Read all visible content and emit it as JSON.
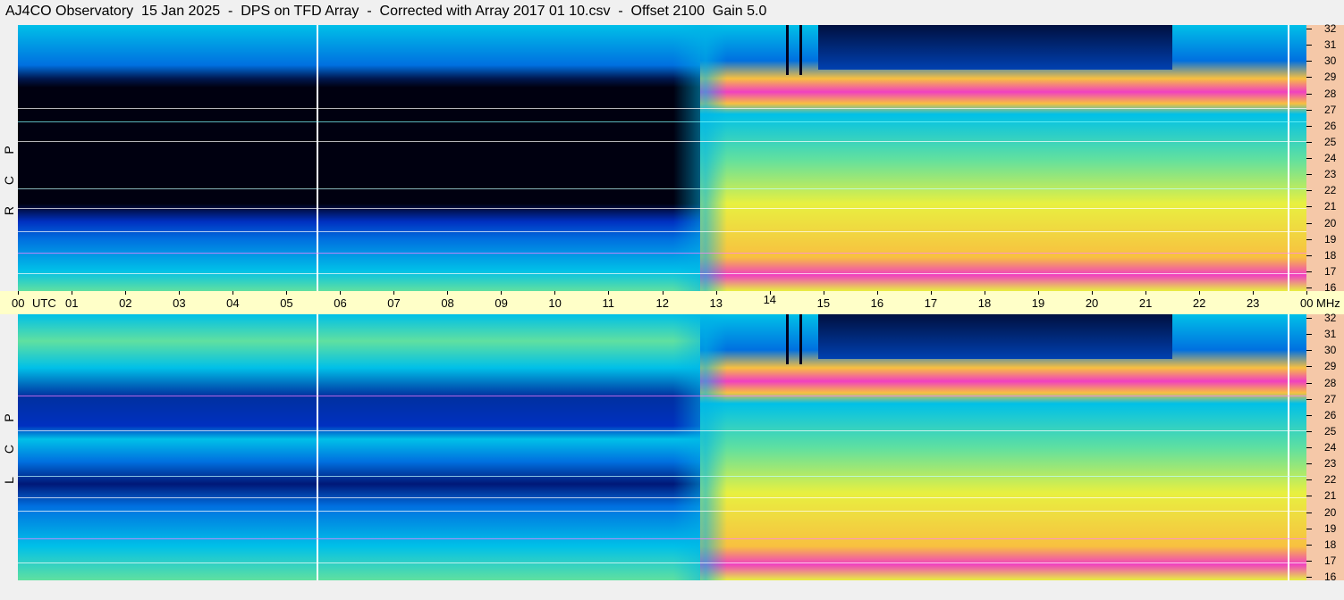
{
  "header": {
    "title": "AJ4CO Observatory  15 Jan 2025  -  DPS on TFD Array  -  Corrected with Array 2017 01 10.csv  -  Offset 2100  Gain 5.0"
  },
  "chart_data": {
    "type": "heatmap",
    "title": "AJ4CO Observatory  15 Jan 2025  -  DPS on TFD Array  -  Corrected with Array 2017 01 10.csv  -  Offset 2100  Gain 5.0",
    "x_axis": {
      "unit_label": "UTC",
      "tick_labels": [
        "00",
        "01",
        "02",
        "03",
        "04",
        "05",
        "06",
        "07",
        "08",
        "09",
        "10",
        "11",
        "12",
        "13",
        "14",
        "15",
        "16",
        "17",
        "18",
        "19",
        "20",
        "21",
        "22",
        "23",
        "00"
      ],
      "range": [
        0,
        24
      ]
    },
    "y_axis": {
      "unit_label": "MHz",
      "tick_labels": [
        "32",
        "31",
        "30",
        "29",
        "28",
        "27",
        "26",
        "25",
        "24",
        "23",
        "22",
        "21",
        "20",
        "19",
        "18",
        "17",
        "16"
      ],
      "range": [
        16,
        32
      ]
    },
    "panels": [
      {
        "label_letters": [
          "R",
          "C",
          "P"
        ]
      },
      {
        "label_letters": [
          "L",
          "C",
          "P"
        ]
      }
    ],
    "colors": {
      "background": "#f0f0f0",
      "time_axis_bg": "#ffffc8",
      "freq_axis_bg": "#f5c8a8",
      "night_black": "#000010",
      "deep_blue": "#0030c0",
      "blue": "#0070e0",
      "cyan": "#00c0e8",
      "green": "#60e0a0",
      "yellow": "#e8f040",
      "orange": "#f8c040",
      "magenta": "#f040c0"
    }
  }
}
